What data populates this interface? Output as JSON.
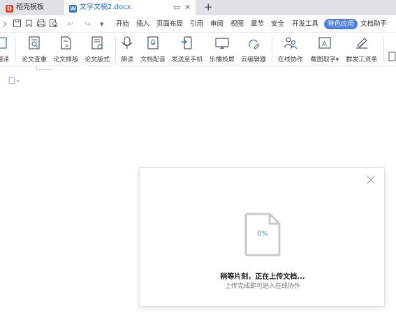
{
  "tabs": [
    {
      "logo": "D",
      "label": "稻壳模板"
    },
    {
      "logo": "W",
      "label": "文字文稿2.docx"
    }
  ],
  "tab_controls": {
    "pin": "▭",
    "close": "✕",
    "new_tab": "+"
  },
  "quick_access": [
    "↩",
    "↪",
    "▾"
  ],
  "menu": [
    {
      "label": "开始"
    },
    {
      "label": "插入"
    },
    {
      "label": "页面布局"
    },
    {
      "label": "引用"
    },
    {
      "label": "审阅"
    },
    {
      "label": "视图"
    },
    {
      "label": "章节"
    },
    {
      "label": "安全"
    },
    {
      "label": "开发工具"
    },
    {
      "label": "特色应用",
      "active": true
    },
    {
      "label": "文档助手"
    }
  ],
  "ribbon": [
    {
      "label": "翻译",
      "icon": "translate-icon"
    },
    {
      "label": "论文查重",
      "icon": "paper-check-icon"
    },
    {
      "label": "论文排版",
      "icon": "paper-layout-icon"
    },
    {
      "label": "论文版式",
      "icon": "paper-format-icon"
    },
    {
      "label": "朗读",
      "icon": "microphone-icon"
    },
    {
      "label": "文档配音",
      "icon": "dubbing-icon"
    },
    {
      "label": "发送至手机",
      "icon": "send-to-phone-icon"
    },
    {
      "label": "乐播投屏",
      "icon": "screen-cast-icon"
    },
    {
      "label": "云编辑器",
      "icon": "cloud-editor-icon"
    },
    {
      "label": "在线协作",
      "icon": "collaborate-icon"
    },
    {
      "label": "截图取字",
      "icon": "ocr-icon",
      "dropdown": "▾"
    },
    {
      "label": "群发工资条",
      "icon": "payslip-icon"
    }
  ],
  "upload": {
    "percent": "0%",
    "title": "稍等片刻，正在上传文档...",
    "subtitle": "上传完成即可进入在线协作"
  }
}
